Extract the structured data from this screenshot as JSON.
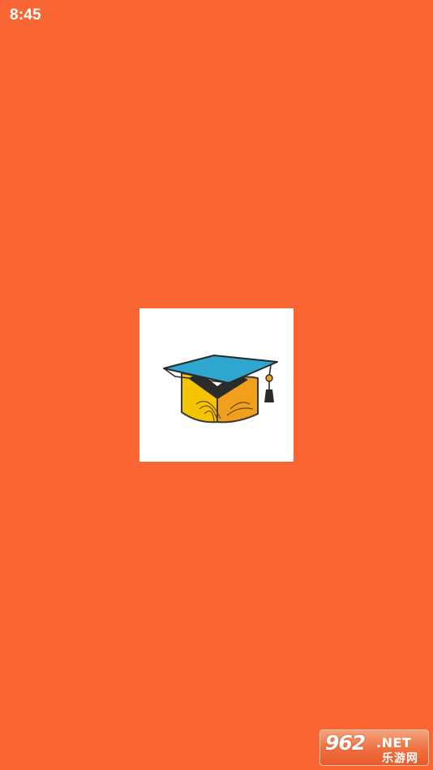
{
  "status_bar": {
    "time": "8:45"
  },
  "splash": {
    "background_color": "#F96633",
    "logo_icon": "graduation-cap-book-icon",
    "logo_tile_color": "#FFFFFF"
  },
  "watermark": {
    "number": "962",
    "tld": ".NET",
    "site_name": "乐游网"
  }
}
